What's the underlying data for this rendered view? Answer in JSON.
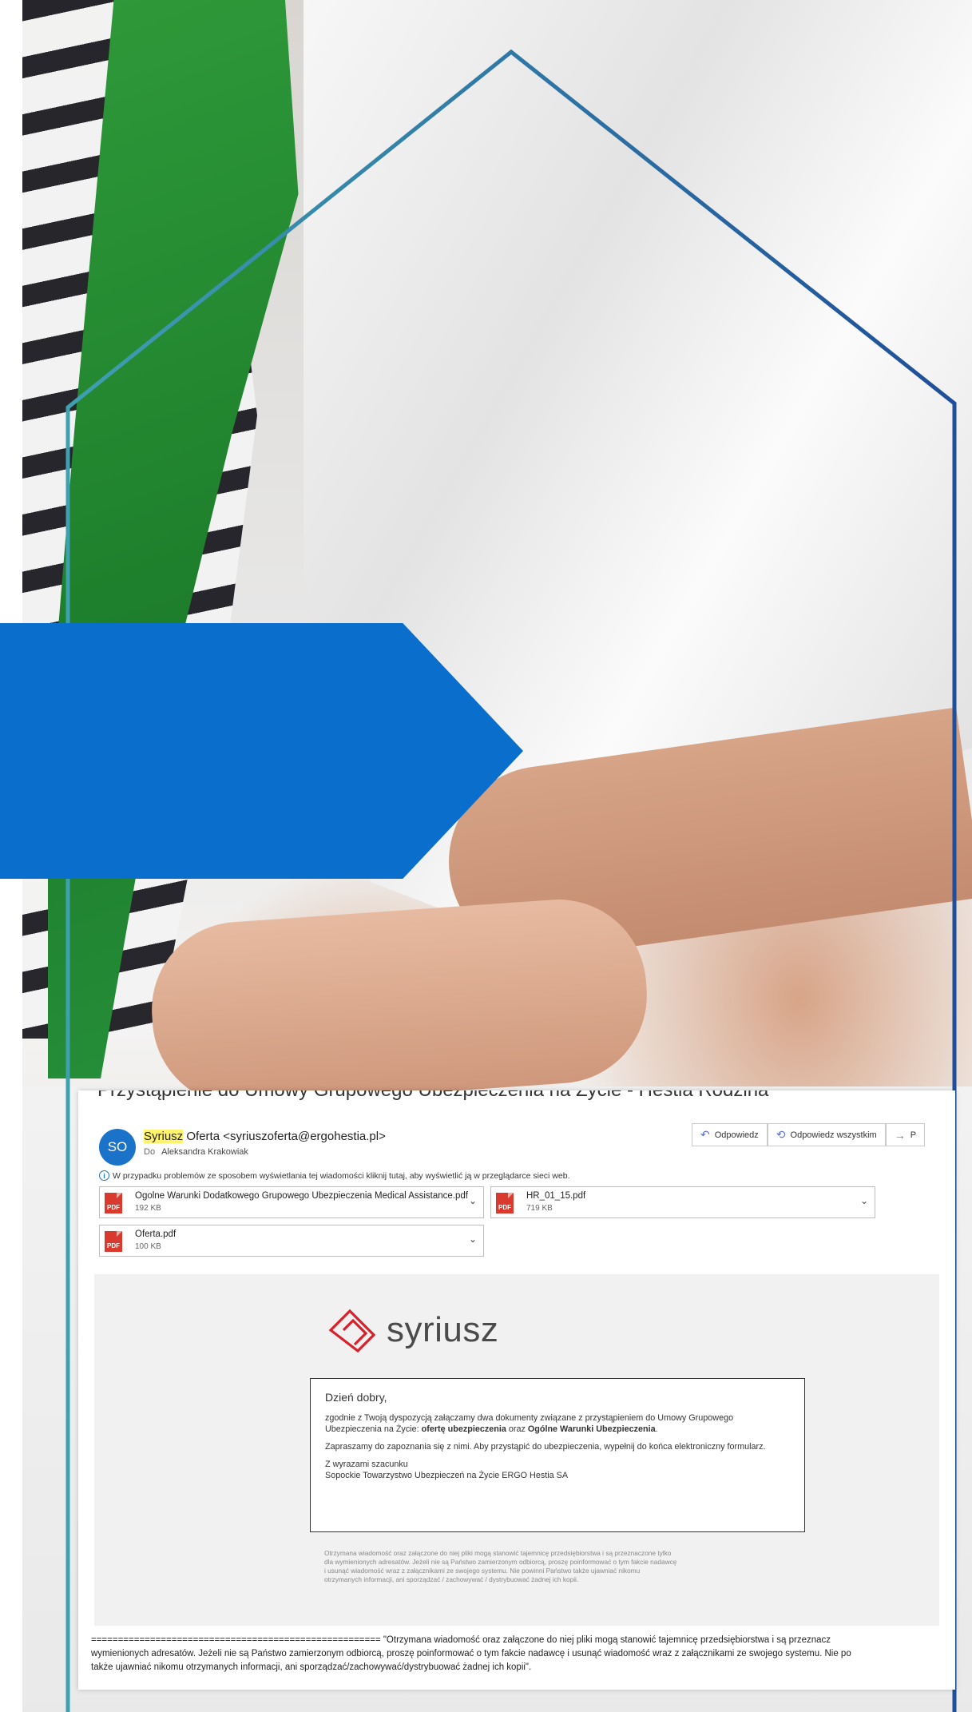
{
  "email": {
    "subject": "Przystąpienie do Umowy Grupowego Ubezpieczenia na Życie - Hestia Rodzina",
    "avatar_initials": "SO",
    "sender_highlight": "Syriusz",
    "sender_rest": " Oferta <syriuszoferta@ergohestia.pl>",
    "to_label": "Do",
    "to_name": "Aleksandra Krakowiak",
    "actions": {
      "reply": "Odpowiedz",
      "reply_all": "Odpowiedz wszystkim",
      "forward": "P"
    },
    "info_text": "W przypadku problemów ze sposobem wyświetlania tej wiadomości kliknij tutaj, aby wyświetlić ją w przeglądarce sieci web.",
    "attachments": [
      {
        "name": "Ogolne Warunki Dodatkowego Grupowego Ubezpieczenia Medical Assistance.pdf",
        "size": "192 KB"
      },
      {
        "name": "HR_01_15.pdf",
        "size": "719 KB"
      },
      {
        "name": "Oferta.pdf",
        "size": "100 KB"
      }
    ],
    "pdf_label": "PDF",
    "logo_text": "syriusz",
    "body": {
      "greeting": "Dzień dobry,",
      "p1_a": "zgodnie z Twoją dyspozycją załączamy dwa dokumenty związane z przystąpieniem do Umowy Grupowego Ubezpieczenia na Życie: ",
      "p1_b": "ofertę ubezpieczenia",
      "p1_c": " oraz ",
      "p1_d": "Ogólne Warunki Ubezpieczenia",
      "p1_e": ".",
      "p2": "Zapraszamy do zapoznania się z nimi. Aby przystąpić do ubezpieczenia, wypełnij do końca elektroniczny formularz.",
      "p3a": "Z wyrazami szacunku",
      "p3b": "Sopockie Towarzystwo Ubezpieczeń na Życie ERGO Hestia SA"
    },
    "disclaimer": [
      "Otrzymana wiadomość oraz załączone do niej pliki mogą stanowić tajemnicę przedsiębiorstwa i są przeznaczone tylko",
      "dla wymienionych adresatów. Jeżeli nie są Państwo zamierzonym odbiorcą, proszę poinformować o tym fakcie nadawcę",
      "i usunąć wiadomość wraz z załącznikami ze swojego systemu. Nie powinni Państwo także ujawniać nikomu",
      "otrzymanych informacji, ani sporządzać / zachowywać / dystrybuować żadnej ich kopii."
    ],
    "footer": [
      "====================================================== \"Otrzymana wiadomość oraz załączone do niej pliki mogą stanowić tajemnicę przedsiębiorstwa i są przeznacz",
      "wymienionych adresatów. Jeżeli nie są Państwo zamierzonym odbiorcą, proszę poinformować o tym fakcie nadawcę i usunąć wiadomość wraz z załącznikami ze swojego systemu. Nie po",
      "także ujawniać nikomu otrzymanych informacji, ani sporządzać/zachowywać/dystrybuować żadnej ich kopii\"."
    ]
  },
  "colors": {
    "brand_blue": "#0a6fcc",
    "line_teal": "#3a94a8",
    "logo_red": "#d8202a"
  }
}
